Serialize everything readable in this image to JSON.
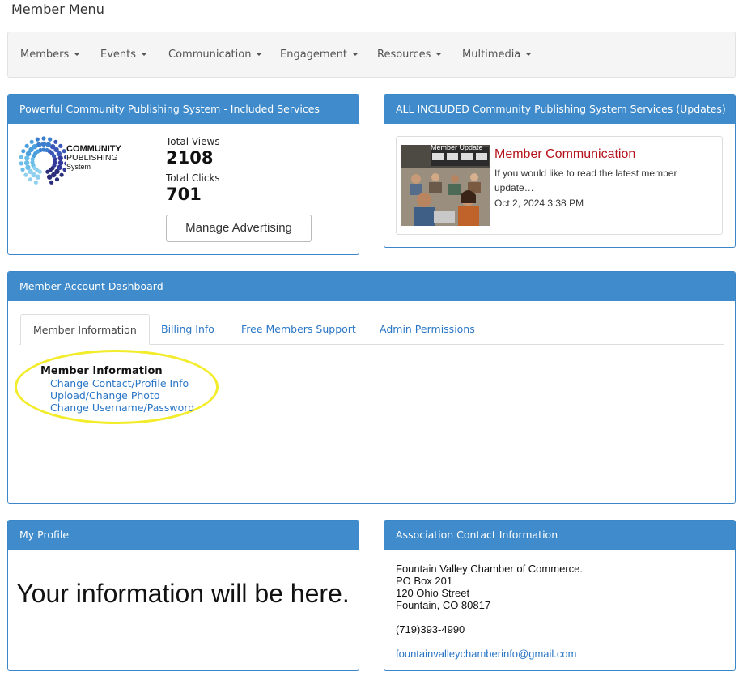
{
  "page": {
    "title": "Member Menu"
  },
  "nav": {
    "items": [
      {
        "label": "Members"
      },
      {
        "label": "Events"
      },
      {
        "label": "Communication"
      },
      {
        "label": "Engagement"
      },
      {
        "label": "Resources"
      },
      {
        "label": "Multimedia"
      }
    ]
  },
  "services_panel": {
    "title": "Powerful Community Publishing System - Included Services",
    "logo": {
      "line1": "COMMUNITY",
      "line2": "PUBLISHING",
      "line3": "System"
    },
    "total_views_label": "Total Views",
    "total_views": "2108",
    "total_clicks_label": "Total Clicks",
    "total_clicks": "701",
    "manage_button": "Manage Advertising"
  },
  "updates_panel": {
    "title": "ALL INCLUDED Community Publishing System Services (Updates)",
    "item": {
      "thumbnail_caption": "Member Update",
      "title": "Member Communication",
      "excerpt": "If you would like to read the latest member update…",
      "date": "Oct 2, 2024 3:38 PM"
    }
  },
  "dashboard": {
    "title": "Member Account Dashboard",
    "tabs": [
      {
        "label": "Member Information"
      },
      {
        "label": "Billing Info"
      },
      {
        "label": "Free Members Support"
      },
      {
        "label": "Admin Permissions"
      }
    ],
    "section_heading": "Member Information",
    "links": [
      {
        "label": "Change Contact/Profile Info"
      },
      {
        "label": "Upload/Change Photo"
      },
      {
        "label": "Change Username/Password"
      }
    ]
  },
  "profile": {
    "title": "My Profile",
    "message": "Your information will be here."
  },
  "contact": {
    "title": "Association Contact Information",
    "name": "Fountain Valley Chamber of Commerce.",
    "po_box": "PO Box 201",
    "street": "120 Ohio Street",
    "city": "Fountain, CO 80817",
    "phone": "(719)393-4990",
    "email": "fountainvalleychamberinfo@gmail.com"
  },
  "colors": {
    "panel_header": "#3f8bcb",
    "link": "#2a76c6",
    "update_title": "#b5121b",
    "highlight": "#f2ec2a"
  }
}
